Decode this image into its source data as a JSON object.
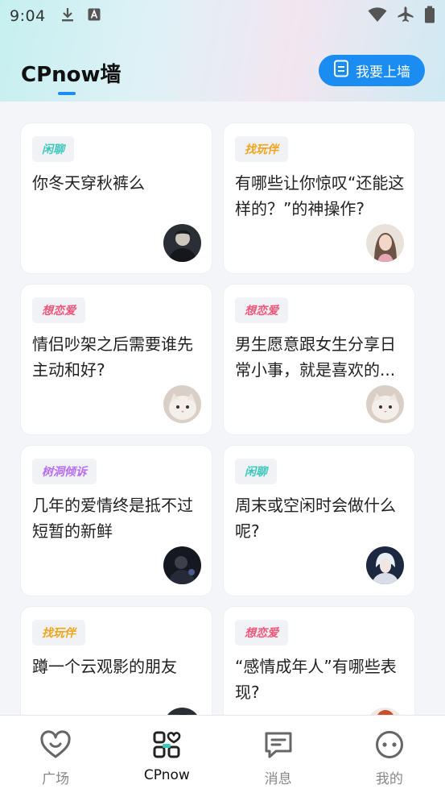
{
  "status": {
    "time": "9:04"
  },
  "header": {
    "title": "CPnow墙",
    "post_button": "我要上墙"
  },
  "cards": [
    {
      "tag": "闲聊",
      "tag_type": "xl",
      "text": "你冬天穿秋裤么",
      "avatar": "dark-man"
    },
    {
      "tag": "找玩伴",
      "tag_type": "zwb",
      "text": "有哪些让你惊叹“还能这样的？”的神操作?",
      "avatar": "girl"
    },
    {
      "tag": "想恋爱",
      "tag_type": "xla",
      "text": "情侣吵架之后需要谁先主动和好?",
      "avatar": "cat"
    },
    {
      "tag": "想恋爱",
      "tag_type": "xla",
      "text": "男生愿意跟女生分享日常小事，就是喜欢的...",
      "avatar": "cat"
    },
    {
      "tag": "树洞倾诉",
      "tag_type": "sd",
      "text": "几年的爱情终是抵不过短暂的新鲜",
      "avatar": "dark-figure"
    },
    {
      "tag": "闲聊",
      "tag_type": "xl",
      "text": "周末或空闲时会做什么呢?",
      "avatar": "white-hair"
    },
    {
      "tag": "找玩伴",
      "tag_type": "zwb",
      "text": "蹲一个云观影的朋友",
      "avatar": "dark-man"
    },
    {
      "tag": "想恋爱",
      "tag_type": "xla",
      "text": "“感情成年人”有哪些表现?",
      "avatar": "red"
    }
  ],
  "nav": [
    {
      "label": "广场",
      "icon": "heart-icon"
    },
    {
      "label": "CPnow",
      "icon": "grid-heart-icon"
    },
    {
      "label": "消息",
      "icon": "message-icon"
    },
    {
      "label": "我的",
      "icon": "face-icon"
    }
  ],
  "colors": {
    "accent": "#1a8cf2",
    "tag_xl": "#3ec7bb",
    "tag_zwb": "#f2a51a",
    "tag_xla": "#f2557a",
    "tag_sd": "#b86df2"
  }
}
